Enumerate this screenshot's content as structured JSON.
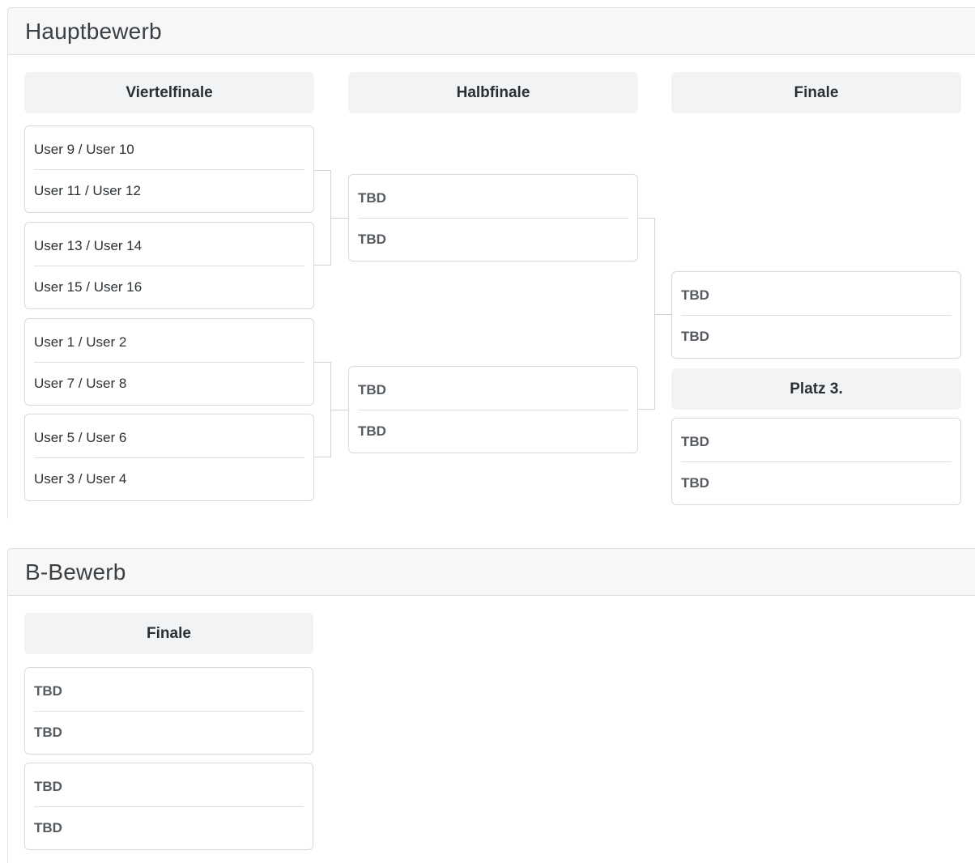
{
  "main": {
    "title": "Hauptbewerb",
    "rounds": [
      "Viertelfinale",
      "Halbfinale",
      "Finale"
    ],
    "quarterfinals": [
      {
        "p1": "User 9 / User 10",
        "p2": "User 11 / User 12"
      },
      {
        "p1": "User 13 / User 14",
        "p2": "User 15 / User 16"
      },
      {
        "p1": "User 1 / User 2",
        "p2": "User 7 / User 8"
      },
      {
        "p1": "User 5 / User 6",
        "p2": "User 3 / User 4"
      }
    ],
    "semifinals": [
      {
        "p1": "TBD",
        "p2": "TBD"
      },
      {
        "p1": "TBD",
        "p2": "TBD"
      }
    ],
    "final": {
      "p1": "TBD",
      "p2": "TBD"
    },
    "third_place_label": "Platz 3.",
    "third_place": {
      "p1": "TBD",
      "p2": "TBD"
    }
  },
  "b": {
    "title": "B-Bewerb",
    "round": "Finale",
    "matches": [
      {
        "p1": "TBD",
        "p2": "TBD"
      },
      {
        "p1": "TBD",
        "p2": "TBD"
      }
    ]
  }
}
